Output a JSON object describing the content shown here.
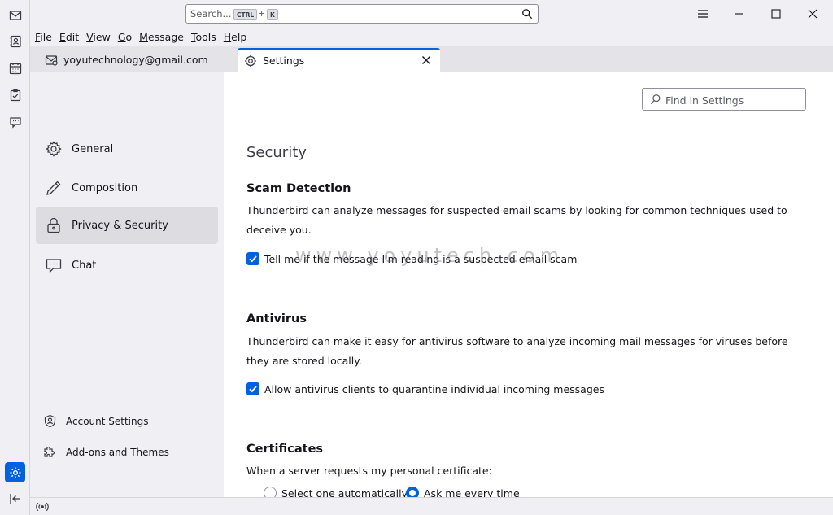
{
  "window": {
    "search_placeholder": "Search...",
    "shortcut_ctrl": "CTRL",
    "shortcut_plus": "+",
    "shortcut_key": "K"
  },
  "menu": [
    {
      "label": "File",
      "key": "F",
      "rest": "ile"
    },
    {
      "label": "Edit",
      "key": "E",
      "rest": "dit"
    },
    {
      "label": "View",
      "key": "V",
      "rest": "iew"
    },
    {
      "label": "Go",
      "key": "G",
      "rest": "o"
    },
    {
      "label": "Message",
      "key": "M",
      "rest": "essage"
    },
    {
      "label": "Tools",
      "key": "T",
      "rest": "ools"
    },
    {
      "label": "Help",
      "key": "H",
      "rest": "elp"
    }
  ],
  "tabs": {
    "mail_label": "yoyutechnology@gmail.com",
    "settings_label": "Settings"
  },
  "sidebar": {
    "items": [
      {
        "label": "General",
        "icon": "gear-icon"
      },
      {
        "label": "Composition",
        "icon": "pencil-icon"
      },
      {
        "label": "Privacy & Security",
        "icon": "lock-icon"
      },
      {
        "label": "Chat",
        "icon": "chat-icon"
      }
    ],
    "account_settings": "Account Settings",
    "addons": "Add-ons and Themes"
  },
  "main": {
    "find_placeholder": "Find in Settings",
    "page_title": "Security",
    "scam": {
      "heading": "Scam Detection",
      "description": "Thunderbird can analyze messages for suspected email scams by looking for common techniques used to deceive you.",
      "checkbox_label": "Tell me if the message I'm reading is a suspected email scam",
      "checked": true
    },
    "antivirus": {
      "heading": "Antivirus",
      "description": "Thunderbird can make it easy for antivirus software to analyze incoming mail messages for viruses before they are stored locally.",
      "checkbox_label": "Allow antivirus clients to quarantine individual incoming messages",
      "checked": true
    },
    "certificates": {
      "heading": "Certificates",
      "prompt": "When a server requests my personal certificate:",
      "option_auto": "Select one automatically",
      "option_ask": "Ask me every time",
      "selected": "Ask me every time"
    },
    "watermark": "www.yoyutech.com"
  },
  "colors": {
    "accent": "#0061e0",
    "selected_nav": "#dcdce1"
  }
}
